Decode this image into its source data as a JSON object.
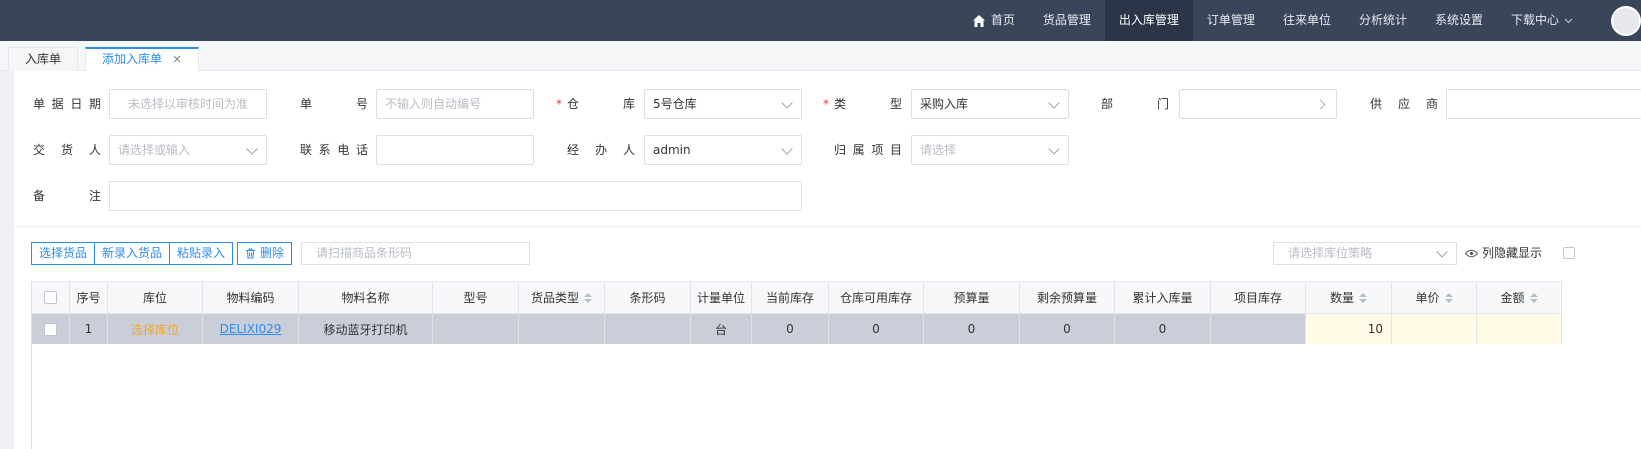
{
  "nav": {
    "home": "首页",
    "items": [
      "货品管理",
      "出入库管理",
      "订单管理",
      "往来单位",
      "分析统计",
      "系统设置",
      "下载中心"
    ],
    "active": "出入库管理"
  },
  "tabs": {
    "tab1": "入库单",
    "tab2": "添加入库单",
    "close": "×"
  },
  "form": {
    "date_label": "单据日期",
    "date_placeholder": "未选择以审核时间为准",
    "docno_label": "单号",
    "docno_placeholder": "不输入则自动编号",
    "warehouse_label": "仓库",
    "warehouse_value": "5号仓库",
    "type_label": "类型",
    "type_value": "采购入库",
    "dept_label": "部门",
    "dept_value": "",
    "supplier_label": "供应商",
    "deliverer_label": "交货人",
    "deliverer_placeholder": "请选择或输入",
    "phone_label": "联系电话",
    "handler_label": "经办人",
    "handler_value": "admin",
    "project_label": "归属项目",
    "project_placeholder": "请选择",
    "remark_label": "备注",
    "required_mark": "*"
  },
  "toolbar": {
    "select_goods": "选择货品",
    "new_goods": "新录入货品",
    "paste_entry": "粘贴录入",
    "delete": "删除",
    "scan_placeholder": "请扫描商品条形码",
    "strategy_placeholder": "请选择库位策略",
    "column_hide": "列隐藏显示"
  },
  "table": {
    "headers": [
      "",
      "序号",
      "库位",
      "物料编码",
      "物料名称",
      "型号",
      "货品类型",
      "条形码",
      "计量单位",
      "当前库存",
      "仓库可用库存",
      "预算量",
      "剩余预算量",
      "累计入库量",
      "项目库存",
      "数量",
      "单价",
      "金额"
    ],
    "rows": [
      {
        "index": "1",
        "location": "选择库位",
        "code": "DELIXI029",
        "name": "移动蓝牙打印机",
        "model": "",
        "goods_type": "",
        "barcode": "",
        "unit": "台",
        "current_stock": "0",
        "available_stock": "0",
        "budget": "0",
        "remaining_budget": "0",
        "cumulative_in": "0",
        "project_stock": "",
        "quantity": "10",
        "unit_price": "",
        "amount": ""
      }
    ]
  },
  "colors": {
    "topbar": "#3a4559",
    "accent": "#2d8cf0",
    "selected_row": "#c9ced8",
    "location_link": "#f5a623",
    "required": "#e4393c"
  }
}
